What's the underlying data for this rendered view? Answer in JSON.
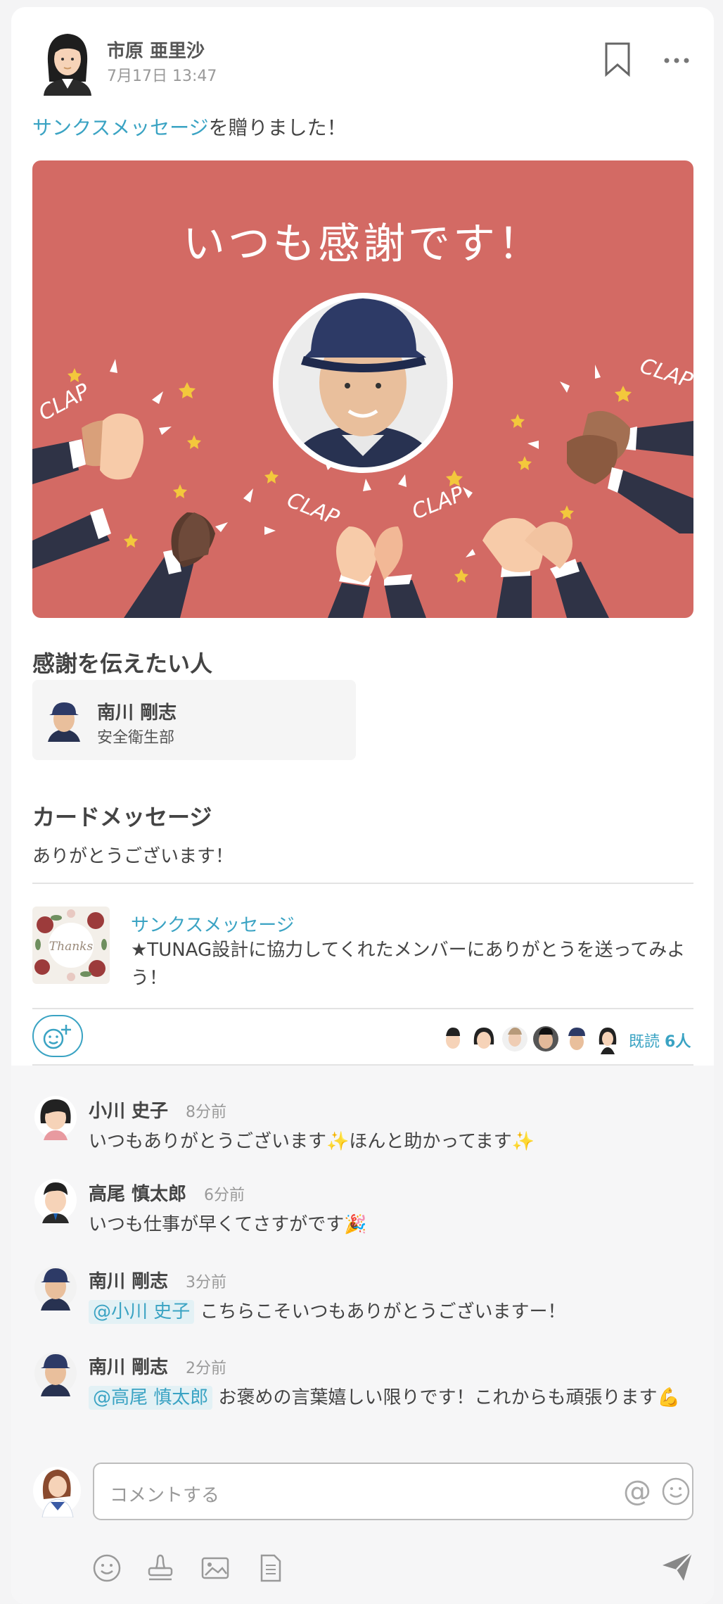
{
  "post": {
    "author": "市原 亜里沙",
    "date": "7月17日 13:47",
    "lead_link": "サンクスメッセージ",
    "lead_rest": "を贈りました！"
  },
  "banner": {
    "title": "いつも感謝です！",
    "clap_text": "CLAP",
    "bg_color": "#d36a64"
  },
  "recipient_section": {
    "title": "感謝を伝えたい人",
    "name": "南川 剛志",
    "dept": "安全衛生部"
  },
  "card_message": {
    "title": "カードメッセージ",
    "text": "ありがとうございます！"
  },
  "campaign": {
    "thumb_text": "Thanks",
    "label": "サンクスメッセージ",
    "description": "★TUNAG設計に協力してくれたメンバーにありがとうを送ってみよう！"
  },
  "reads": {
    "label": "既読",
    "count": "6人"
  },
  "comments": [
    {
      "name": "小川 史子",
      "time": "8分前",
      "text": "いつもありがとうございます✨ほんと助かってます✨"
    },
    {
      "name": "高尾 慎太郎",
      "time": "6分前",
      "text": "いつも仕事が早くてさすがです🎉"
    },
    {
      "name": "南川 剛志",
      "time": "3分前",
      "mention": "@小川 史子",
      "text": "こちらこそいつもありがとうございますー！"
    },
    {
      "name": "南川 剛志",
      "time": "2分前",
      "mention": "@高尾 慎太郎",
      "text": "お褒めの言葉嬉しい限りです！これからも頑張ります💪"
    }
  ],
  "composer": {
    "placeholder": "コメントする",
    "at_symbol": "@"
  },
  "icons": {
    "bookmark": "bookmark-icon",
    "more": "more-icon",
    "reaction": "add-reaction-icon",
    "emoji": "emoji-icon",
    "stamp": "stamp-icon",
    "image": "image-icon",
    "file": "file-icon",
    "send": "send-icon"
  },
  "colors": {
    "accent": "#3aa3c3"
  }
}
